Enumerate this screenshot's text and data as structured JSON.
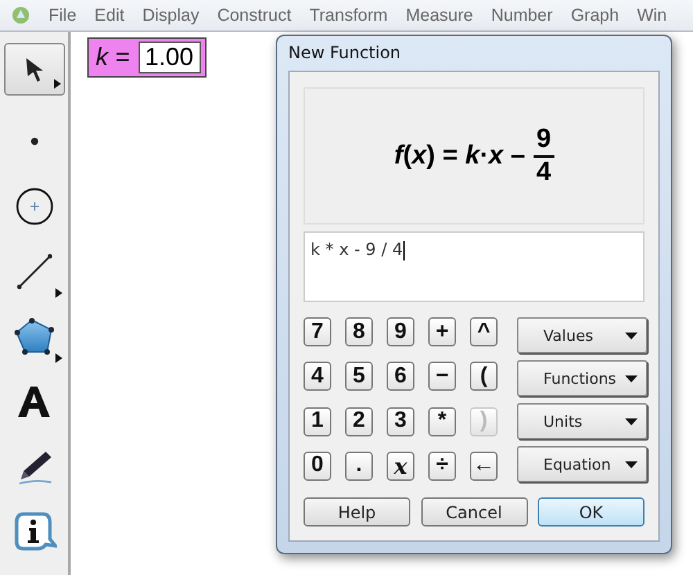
{
  "menu_bar": {
    "items": [
      "File",
      "Edit",
      "Display",
      "Construct",
      "Transform",
      "Measure",
      "Number",
      "Graph",
      "Win"
    ]
  },
  "toolbox": {
    "tools": [
      {
        "kind": "arrow",
        "selected": true,
        "submenu": true
      },
      {
        "kind": "point",
        "selected": false,
        "submenu": false
      },
      {
        "kind": "compass",
        "selected": false,
        "submenu": false
      },
      {
        "kind": "line",
        "selected": false,
        "submenu": true
      },
      {
        "kind": "polygon",
        "selected": false,
        "submenu": true
      },
      {
        "kind": "text",
        "selected": false,
        "submenu": false
      },
      {
        "kind": "marker",
        "selected": false,
        "submenu": false
      },
      {
        "kind": "info",
        "selected": false,
        "submenu": false
      }
    ]
  },
  "canvas": {
    "parameter": {
      "name": "k =",
      "value": "1.00"
    }
  },
  "dialog": {
    "title": "New Function",
    "preview": {
      "expression": "*f*(*x*) = *k*·*x* –",
      "numerator": "9",
      "denominator": "4"
    },
    "input": {
      "value": "k * x - 9 / 4"
    },
    "keys": [
      {
        "label": "7",
        "disabled": false,
        "kind": "plain"
      },
      {
        "label": "8",
        "disabled": false,
        "kind": "plain"
      },
      {
        "label": "9",
        "disabled": false,
        "kind": "plain"
      },
      {
        "label": "+",
        "disabled": false,
        "kind": "plain"
      },
      {
        "label": "^",
        "disabled": false,
        "kind": "plain"
      },
      {
        "label": "4",
        "disabled": false,
        "kind": "plain"
      },
      {
        "label": "5",
        "disabled": false,
        "kind": "plain"
      },
      {
        "label": "6",
        "disabled": false,
        "kind": "plain"
      },
      {
        "label": "−",
        "disabled": false,
        "kind": "plain"
      },
      {
        "label": "(",
        "disabled": false,
        "kind": "plain"
      },
      {
        "label": "1",
        "disabled": false,
        "kind": "plain"
      },
      {
        "label": "2",
        "disabled": false,
        "kind": "plain"
      },
      {
        "label": "3",
        "disabled": false,
        "kind": "plain"
      },
      {
        "label": "*",
        "disabled": false,
        "kind": "plain"
      },
      {
        "label": ")",
        "disabled": true,
        "kind": "plain"
      },
      {
        "label": "0",
        "disabled": false,
        "kind": "plain"
      },
      {
        "label": ".",
        "disabled": false,
        "kind": "plain"
      },
      {
        "label": "x",
        "disabled": false,
        "kind": "variable"
      },
      {
        "label": "÷",
        "disabled": false,
        "kind": "plain"
      },
      {
        "label": "←",
        "disabled": false,
        "kind": "plain"
      }
    ],
    "menus": [
      "Values",
      "Functions",
      "Units",
      "Equation"
    ],
    "buttons": [
      {
        "label": "Help",
        "default": false
      },
      {
        "label": "Cancel",
        "default": false
      },
      {
        "label": "OK",
        "default": true
      }
    ]
  }
}
